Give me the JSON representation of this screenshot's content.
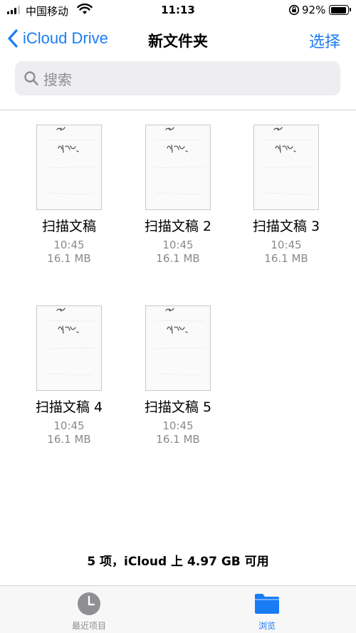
{
  "status_bar": {
    "carrier": "中国移动",
    "time": "11:13",
    "battery_percent": "92%",
    "battery_level": 0.92
  },
  "nav": {
    "back_label": "iCloud Drive",
    "title": "新文件夹",
    "select_label": "选择"
  },
  "search": {
    "placeholder": "搜索"
  },
  "files": [
    {
      "name": "扫描文稿",
      "time": "10:45",
      "size": "16.1 MB"
    },
    {
      "name": "扫描文稿 2",
      "time": "10:45",
      "size": "16.1 MB"
    },
    {
      "name": "扫描文稿 3",
      "time": "10:45",
      "size": "16.1 MB"
    },
    {
      "name": "扫描文稿 4",
      "time": "10:45",
      "size": "16.1 MB"
    },
    {
      "name": "扫描文稿 5",
      "time": "10:45",
      "size": "16.1 MB"
    }
  ],
  "footer": {
    "summary": "5 项，iCloud 上 4.97 GB 可用"
  },
  "tab_bar": {
    "tabs": [
      {
        "label": "最近项目",
        "icon": "clock-icon",
        "active": false
      },
      {
        "label": "浏览",
        "icon": "folder-icon",
        "active": true
      }
    ]
  },
  "colors": {
    "accent": "#1a7cf5",
    "secondary_text": "#8a8a8e"
  }
}
